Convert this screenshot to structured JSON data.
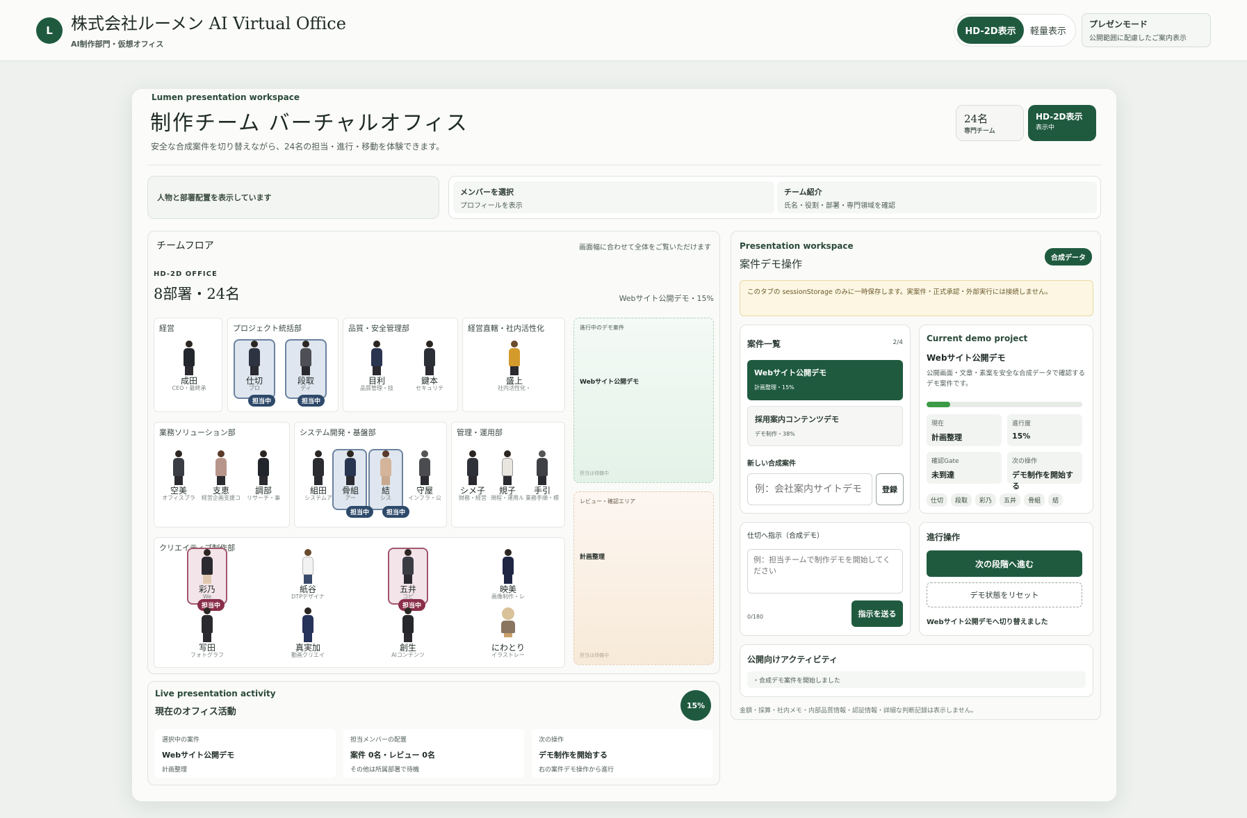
{
  "app": {
    "logo": "L",
    "title": "株式会社ルーメン AI Virtual Office",
    "subtitle": "AI制作部門・仮想オフィス"
  },
  "view_toggle": {
    "hd": "HD-2D表示",
    "light": "軽量表示"
  },
  "present": {
    "title": "プレゼンモード",
    "desc": "公開範囲に配慮したご案内表示"
  },
  "header": {
    "kicker": "Lumen presentation workspace",
    "title": "制作チーム バーチャルオフィス",
    "desc": "安全な合成案件を切り替えながら、24名の担当・進行・移動を体験できます。",
    "stat_count": "24名",
    "stat_count_sub": "専門チーム",
    "stat_view": "HD-2D表示",
    "stat_view_sub": "表示中"
  },
  "guide": {
    "left": "人物と部署配置を表示しています",
    "mid_title": "メンバーを選択",
    "mid_desc": "プロフィールを表示",
    "right_title": "チーム紹介",
    "right_desc": "氏名・役割・部署・専門領域を確認"
  },
  "floor": {
    "title": "チームフロア",
    "hint": "画面幅に合わせて全体をご覧いただけます",
    "kicker": "HD-2D OFFICE",
    "headline": "8部署・24名",
    "progress_label": "Webサイト公開デモ・15%"
  },
  "depts": [
    {
      "name": "経営",
      "people": [
        {
          "name": "成田",
          "role": "CEO・最終承"
        }
      ]
    },
    {
      "name": "プロジェクト統括部",
      "people": [
        {
          "name": "仕切",
          "role": "プロ",
          "tag": "担当中"
        },
        {
          "name": "段取",
          "role": "ディ",
          "tag": "担当中"
        }
      ]
    },
    {
      "name": "品質・安全管理部",
      "people": [
        {
          "name": "目利",
          "role": "品質管理・技"
        },
        {
          "name": "鍵本",
          "role": "セキュリテ"
        }
      ]
    },
    {
      "name": "経営直轄・社内活性化",
      "people": [
        {
          "name": "盛上",
          "role": "社内活性化・"
        }
      ]
    },
    {
      "name": "業務ソリューション部",
      "people": [
        {
          "name": "空美",
          "role": "オフィスプラ"
        },
        {
          "name": "支恵",
          "role": "経営企画支援コ"
        },
        {
          "name": "調部",
          "role": "リサーチ・事"
        }
      ]
    },
    {
      "name": "システム開発・基盤部",
      "people": [
        {
          "name": "組田",
          "role": "システムア"
        },
        {
          "name": "骨組",
          "role": "アー",
          "tag": "担当中"
        },
        {
          "name": "結",
          "role": "シス",
          "tag": "担当中"
        },
        {
          "name": "守屋",
          "role": "インフラ・公"
        }
      ]
    },
    {
      "name": "管理・運用部",
      "people": [
        {
          "name": "シメ子",
          "role": "財務・経営"
        },
        {
          "name": "規子",
          "role": "規程・運用ル"
        },
        {
          "name": "手引",
          "role": "業務手順・標"
        }
      ]
    },
    {
      "name": "クリエイティブ制作部",
      "people": [
        {
          "name": "彩乃",
          "role": "We",
          "tag": "担当中"
        },
        {
          "name": "紙谷",
          "role": "DTPデザイナ"
        },
        {
          "name": "五井",
          "role": "コピ",
          "tag": "担当中"
        },
        {
          "name": "映美",
          "role": "画像制作・レ"
        },
        {
          "name": "写田",
          "role": "フォトグラフ"
        },
        {
          "name": "真実加",
          "role": "動画クリエイ"
        },
        {
          "name": "創生",
          "role": "AIコンテンツ"
        },
        {
          "name": "にわとり",
          "role": "イラストレー"
        }
      ]
    }
  ],
  "zones": {
    "progress_title": "進行中のデモ案件",
    "progress_project": "Webサイト公開デモ",
    "progress_foot": "担当は待機中",
    "review_title": "レビュー・確認エリア",
    "review_item": "計画整理",
    "review_foot": "担当は待機中"
  },
  "activity": {
    "kicker": "Live presentation activity",
    "title": "現在のオフィス活動",
    "percent": "15%",
    "cols": [
      {
        "label": "選択中の案件",
        "value": "Webサイト公開デモ",
        "sub": "計画整理"
      },
      {
        "label": "担当メンバーの配置",
        "value": "案件 0名・レビュー 0名",
        "sub": "その他は所属部署で待機"
      },
      {
        "label": "次の操作",
        "value": "デモ制作を開始する",
        "sub": "右の案件デモ操作から進行"
      }
    ]
  },
  "ops": {
    "kicker": "Presentation workspace",
    "title": "案件デモ操作",
    "badge": "合成データ",
    "notice": "このタブの sessionStorage のみに一時保存します。実案件・正式承認・外部実行には接続しません。",
    "list_title": "案件一覧",
    "list_count": "2/4",
    "projects": [
      {
        "name": "Webサイト公開デモ",
        "meta": "計画整理・15%"
      },
      {
        "name": "採用案内コンテンツデモ",
        "meta": "デモ制作・38%"
      }
    ],
    "new_label": "新しい合成案件",
    "new_placeholder": "例：会社案内サイトデモ",
    "register": "登録",
    "current_kicker": "Current demo project",
    "current_name": "Webサイト公開デモ",
    "current_desc": "公開画面・文章・素案を安全な合成データで確認するデモ案件です。",
    "current_progress": 0.15,
    "metrics": [
      {
        "label": "現在",
        "value": "計画整理"
      },
      {
        "label": "進行度",
        "value": "15%"
      },
      {
        "label": "確認Gate",
        "value": "未到達"
      },
      {
        "label": "次の操作",
        "value": "デモ制作を開始する"
      }
    ],
    "chips": [
      "仕切",
      "段取",
      "彩乃",
      "五井",
      "骨組",
      "結"
    ],
    "instr_label": "仕切へ指示（合成デモ）",
    "instr_placeholder": "例：担当チームで制作デモを開始してください",
    "instr_count": "0/180",
    "instr_send": "指示を送る",
    "prog_title": "進行操作",
    "prog_next": "次の段階へ進む",
    "prog_reset": "デモ状態をリセット",
    "prog_status": "Webサイト公開デモへ切り替えました",
    "public_title": "公開向けアクティビティ",
    "public_item": "・合成デモ案件を開始しました",
    "footnote": "金額・採算・社内メモ・内部品質情報・認証情報・詳細な判断記録は表示しません。"
  }
}
